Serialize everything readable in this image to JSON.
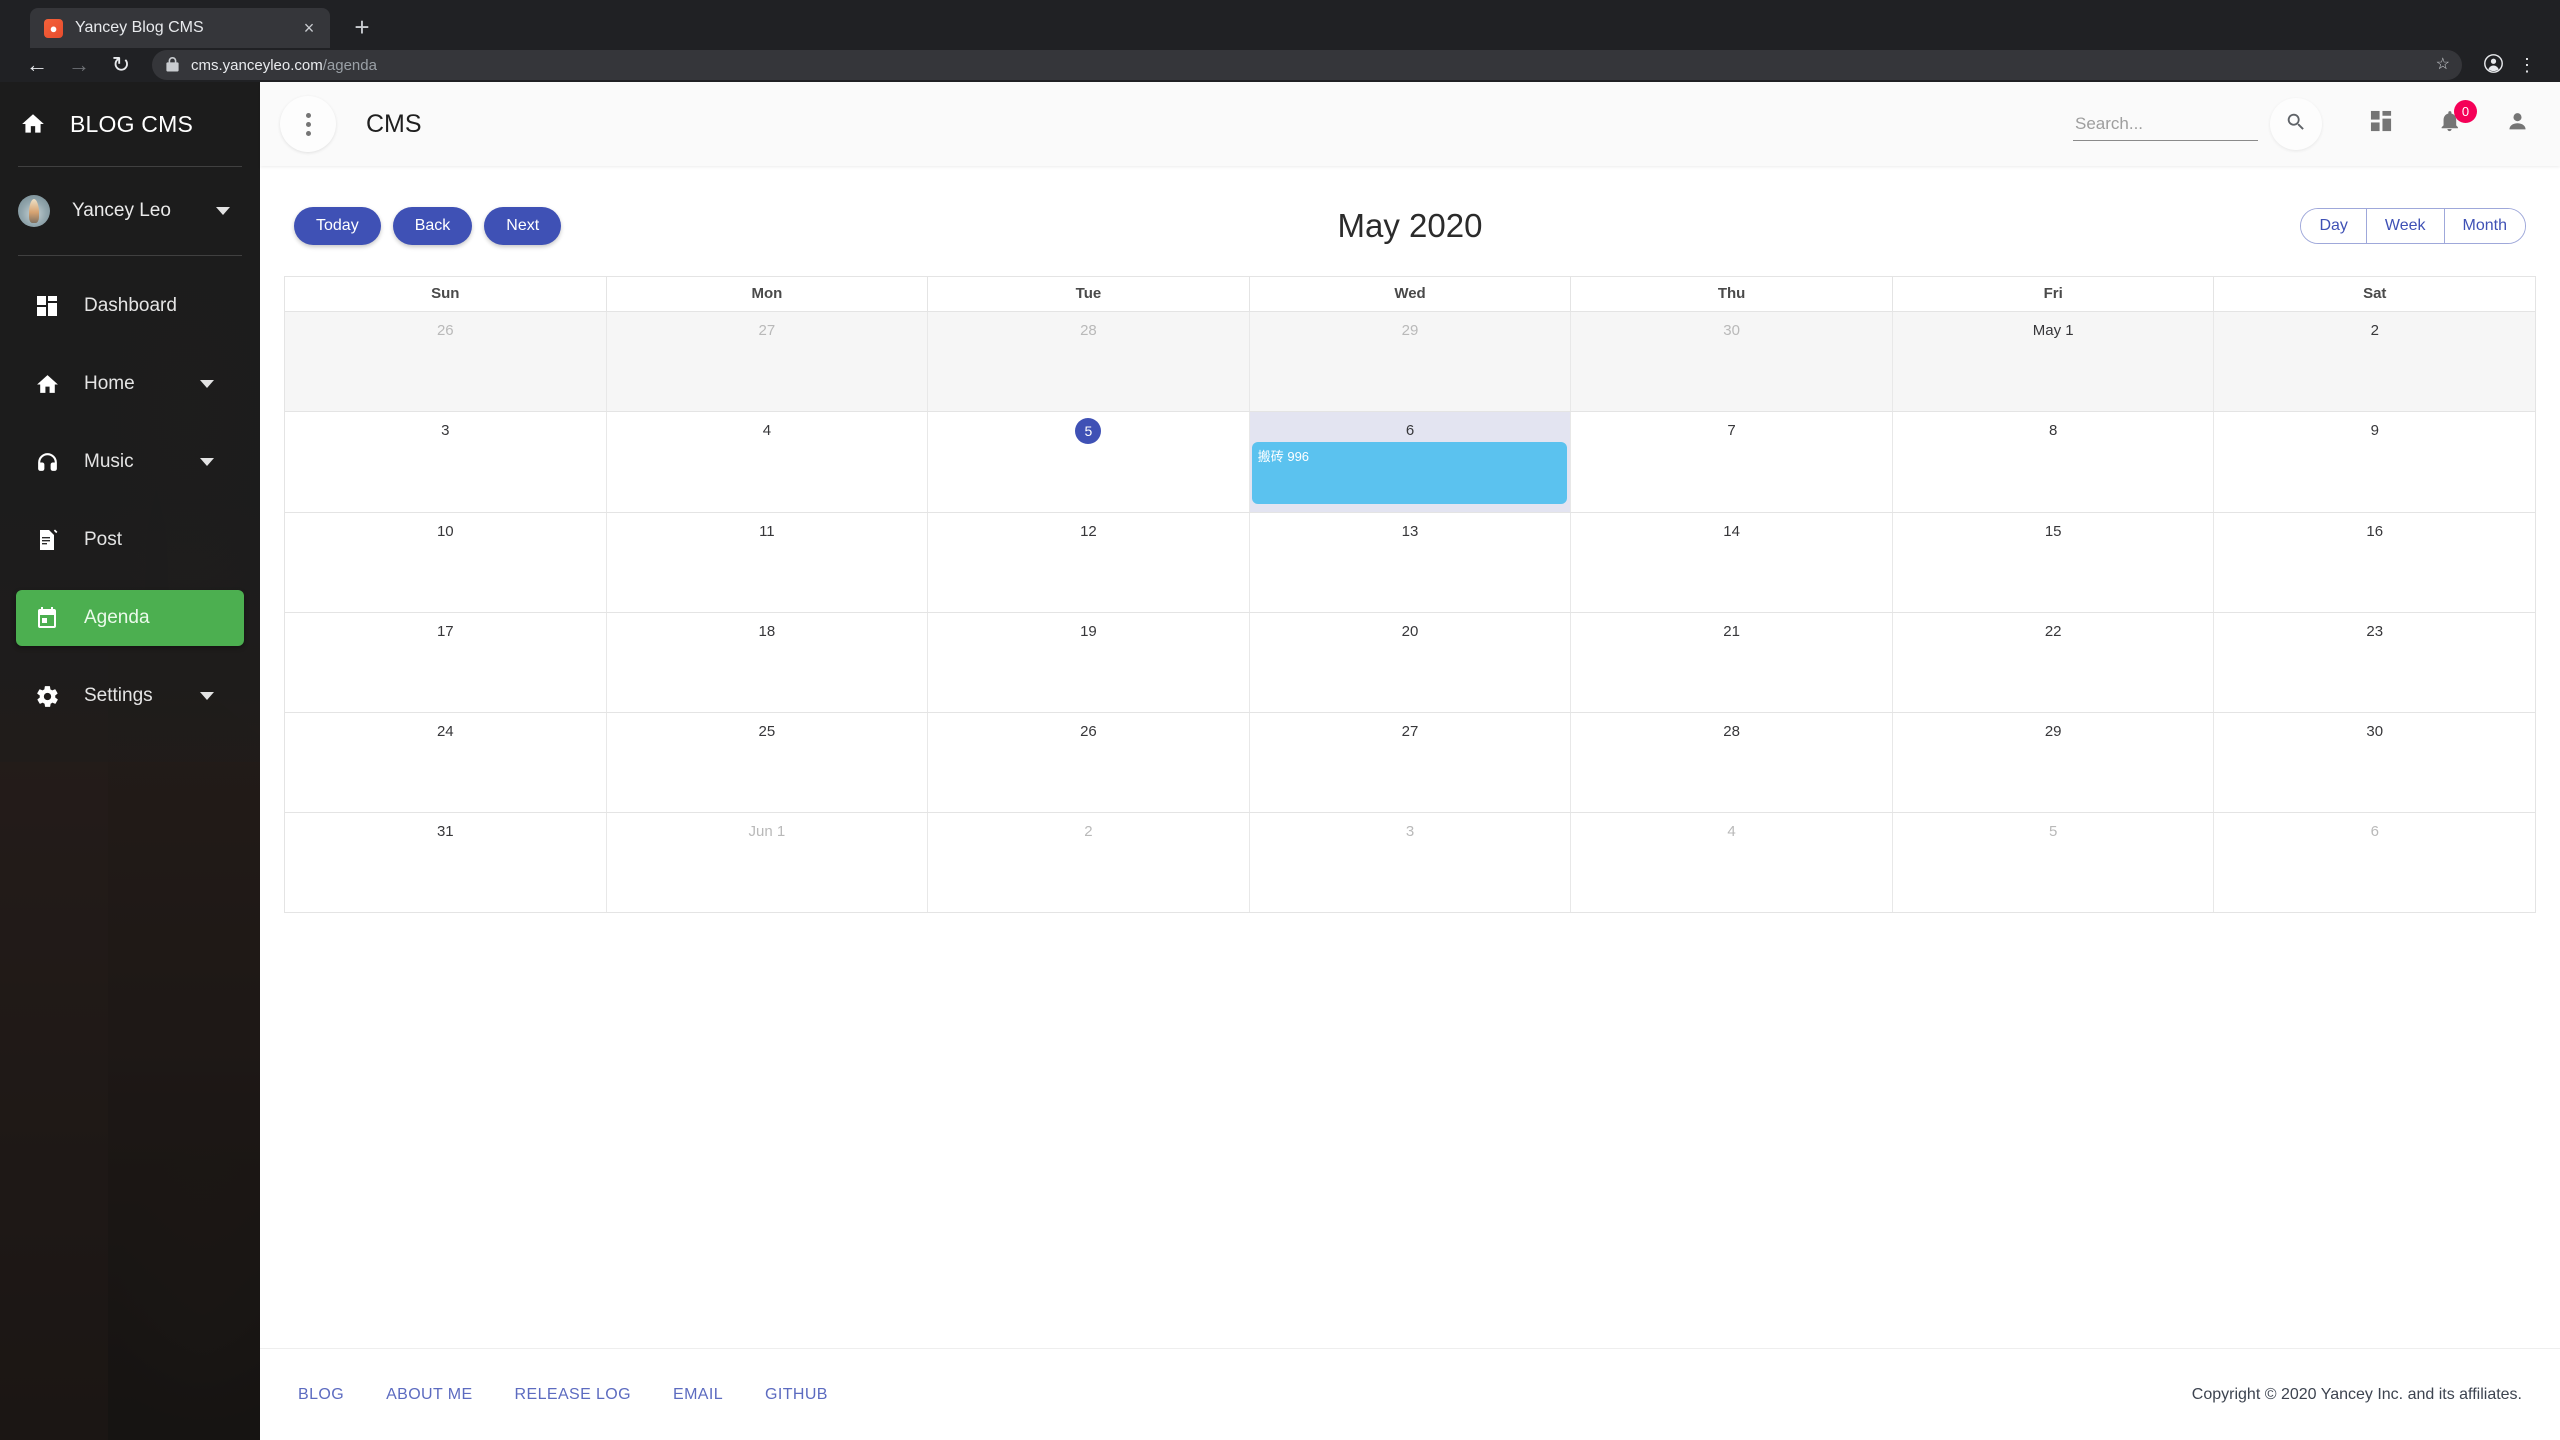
{
  "browser": {
    "tab": {
      "title": "Yancey Blog CMS",
      "favicon": "cms-logo-icon",
      "close": "×"
    },
    "new_tab": "+",
    "nav": {
      "back": "←",
      "forward": "→",
      "reload": "↻"
    },
    "omnibox": {
      "lock": "🔒",
      "domain": "cms.yanceyleo.com",
      "path": "/agenda",
      "star": "☆"
    },
    "profile": "profile-icon",
    "menu": "⋮"
  },
  "sidebar": {
    "brand": "BLOG CMS",
    "user": {
      "name": "Yancey Leo"
    },
    "items": [
      {
        "label": "Dashboard",
        "icon": "dashboard-icon",
        "active": false,
        "expandable": false
      },
      {
        "label": "Home",
        "icon": "home-icon",
        "active": false,
        "expandable": true
      },
      {
        "label": "Music",
        "icon": "headphones-icon",
        "active": false,
        "expandable": true
      },
      {
        "label": "Post",
        "icon": "post-icon",
        "active": false,
        "expandable": false
      },
      {
        "label": "Agenda",
        "icon": "calendar-icon",
        "active": true,
        "expandable": false
      },
      {
        "label": "Settings",
        "icon": "gear-icon",
        "active": false,
        "expandable": true
      }
    ]
  },
  "appbar": {
    "title": "CMS",
    "search": {
      "value": "",
      "placeholder": "Search..."
    },
    "notifications_count": "0"
  },
  "calendar_toolbar": {
    "today": "Today",
    "back": "Back",
    "next": "Next",
    "title": "May 2020",
    "views": [
      "Day",
      "Week",
      "Month"
    ],
    "active_view": "Month"
  },
  "calendar": {
    "weekday_headers": [
      "Sun",
      "Mon",
      "Tue",
      "Wed",
      "Thu",
      "Fri",
      "Sat"
    ],
    "rows": [
      {
        "cells": [
          {
            "label": "26",
            "off": true
          },
          {
            "label": "27",
            "off": true
          },
          {
            "label": "28",
            "off": true
          },
          {
            "label": "29",
            "off": true
          },
          {
            "label": "30",
            "off": true
          },
          {
            "label": "May 1",
            "off": false
          },
          {
            "label": "2",
            "off": false
          }
        ]
      },
      {
        "cells": [
          {
            "label": "3",
            "off": false
          },
          {
            "label": "4",
            "off": false
          },
          {
            "label": "5",
            "off": false,
            "today": true
          },
          {
            "label": "6",
            "off": false,
            "highlight": true,
            "event": "搬砖 996"
          },
          {
            "label": "7",
            "off": false
          },
          {
            "label": "8",
            "off": false
          },
          {
            "label": "9",
            "off": false
          }
        ]
      },
      {
        "cells": [
          {
            "label": "10",
            "off": false
          },
          {
            "label": "11",
            "off": false
          },
          {
            "label": "12",
            "off": false
          },
          {
            "label": "13",
            "off": false
          },
          {
            "label": "14",
            "off": false
          },
          {
            "label": "15",
            "off": false
          },
          {
            "label": "16",
            "off": false
          }
        ]
      },
      {
        "cells": [
          {
            "label": "17",
            "off": false
          },
          {
            "label": "18",
            "off": false
          },
          {
            "label": "19",
            "off": false
          },
          {
            "label": "20",
            "off": false
          },
          {
            "label": "21",
            "off": false
          },
          {
            "label": "22",
            "off": false
          },
          {
            "label": "23",
            "off": false
          }
        ]
      },
      {
        "cells": [
          {
            "label": "24",
            "off": false
          },
          {
            "label": "25",
            "off": false
          },
          {
            "label": "26",
            "off": false
          },
          {
            "label": "27",
            "off": false
          },
          {
            "label": "28",
            "off": false
          },
          {
            "label": "29",
            "off": false
          },
          {
            "label": "30",
            "off": false
          }
        ]
      },
      {
        "cells": [
          {
            "label": "31",
            "off": false
          },
          {
            "label": "Jun 1",
            "off": true
          },
          {
            "label": "2",
            "off": true
          },
          {
            "label": "3",
            "off": true
          },
          {
            "label": "4",
            "off": true
          },
          {
            "label": "5",
            "off": true
          },
          {
            "label": "6",
            "off": true
          }
        ]
      }
    ]
  },
  "footer": {
    "links": [
      "BLOG",
      "ABOUT ME",
      "RELEASE LOG",
      "EMAIL",
      "GITHUB"
    ],
    "copyright": "Copyright © 2020 Yancey Inc. and its affiliates."
  },
  "colors": {
    "accent_green": "#4caf50",
    "primary_indigo": "#3f51b5",
    "event_blue": "#5bc2ef",
    "badge_red": "#f50057"
  }
}
